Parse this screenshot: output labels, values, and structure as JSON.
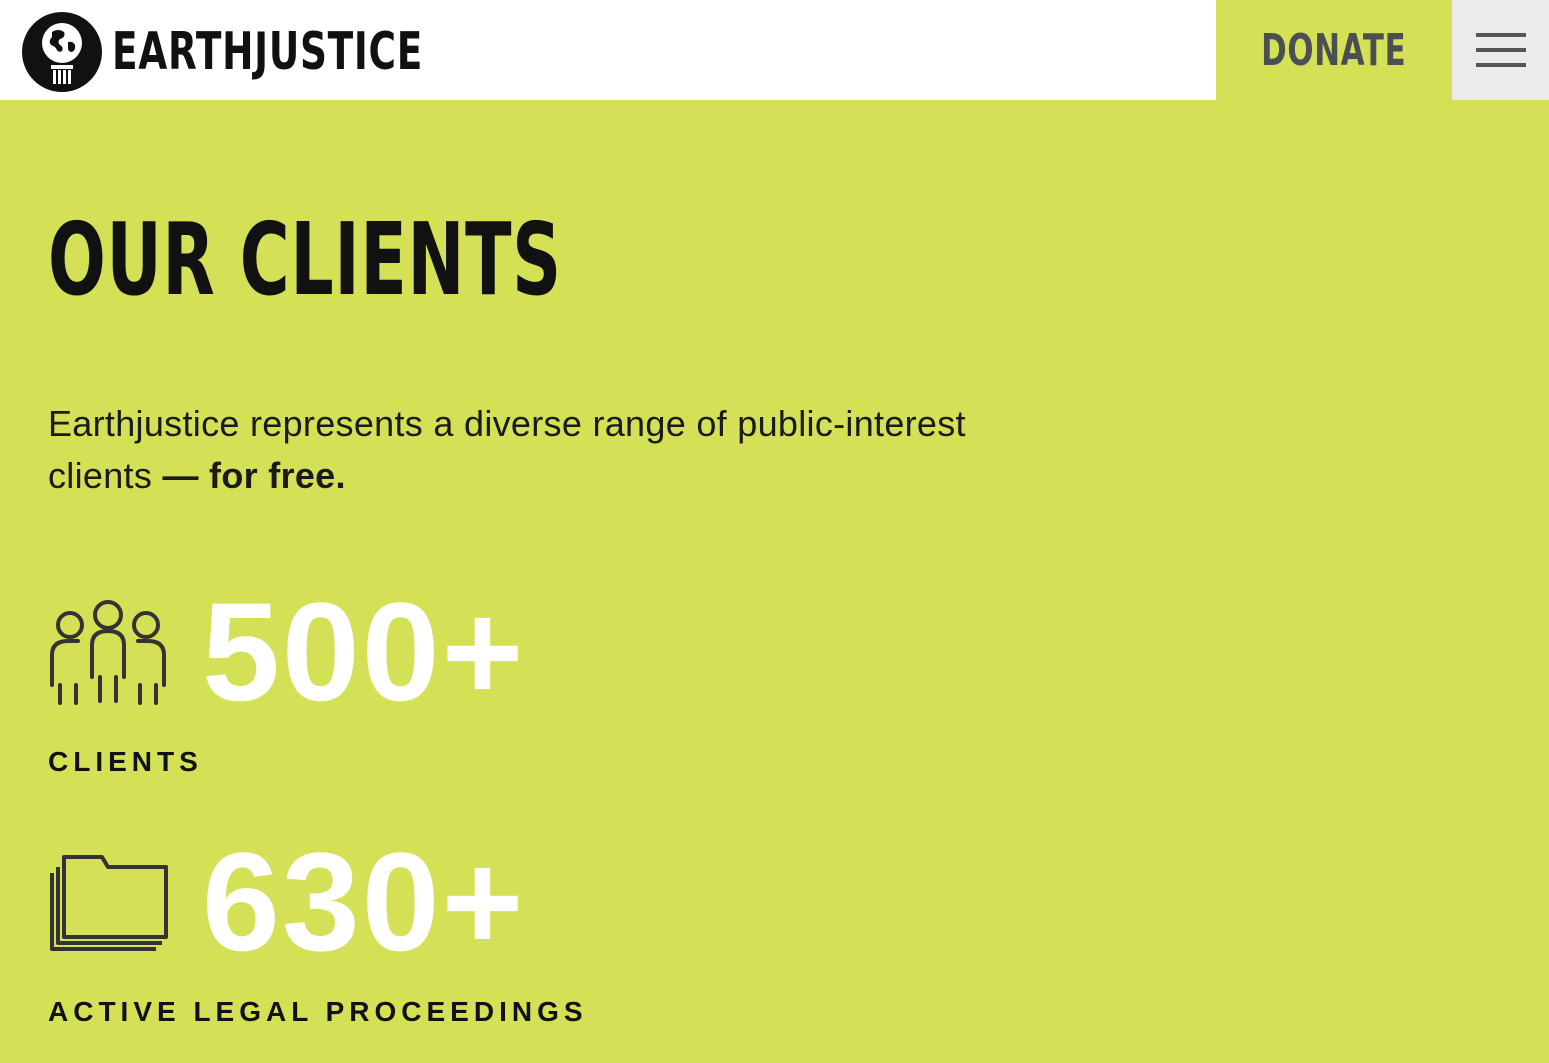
{
  "header": {
    "logo_text": "EARTHJUSTICE",
    "donate_label": "DONATE",
    "menu_icon": "hamburger-menu-icon"
  },
  "main": {
    "title": "OUR CLIENTS",
    "intro_text": "Earthjustice represents a diverse range of public-interest clients ",
    "intro_bold": "— for free.",
    "stats": [
      {
        "icon": "people-group-icon",
        "value": "500+",
        "label": "CLIENTS"
      },
      {
        "icon": "folder-stack-icon",
        "value": "630+",
        "label": "ACTIVE LEGAL PROCEEDINGS"
      }
    ]
  },
  "colors": {
    "accent": "#d4e055",
    "text": "#111111",
    "stat_value": "#ffffff",
    "donate_text": "#4b4f52",
    "menu_bg": "#ebebeb"
  }
}
